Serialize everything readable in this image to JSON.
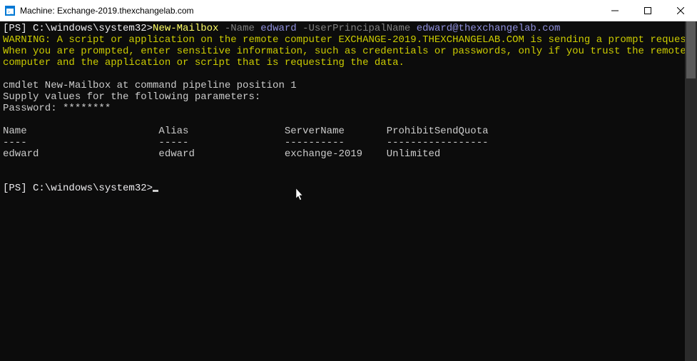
{
  "titlebar": {
    "title": "Machine: Exchange-2019.thexchangelab.com"
  },
  "console": {
    "prompt1_bracket": "[PS]",
    "prompt1_path": " C:\\windows\\system32>",
    "cmdlet": "New-Mailbox",
    "param1": " -Name",
    "value1": " edward",
    "param2": " -UserPrincipalName",
    "value2": " edward@thexchangelab.com",
    "warning_line1": "WARNING: A script or application on the remote computer EXCHANGE-2019.THEXCHANGELAB.COM is sending a prompt request.",
    "warning_line2": "When you are prompted, enter sensitive information, such as credentials or passwords, only if you trust the remote",
    "warning_line3": "computer and the application or script that is requesting the data.",
    "cmdlet_pos": "cmdlet New-Mailbox at command pipeline position 1",
    "supply_params": "Supply values for the following parameters:",
    "password_line": "Password: ********",
    "table_header": "Name                      Alias                ServerName       ProhibitSendQuota",
    "table_sep": "----                      -----                ----------       -----------------",
    "table_row": "edward                    edward               exchange-2019    Unlimited",
    "prompt2_bracket": "[PS]",
    "prompt2_path": " C:\\windows\\system32>"
  }
}
